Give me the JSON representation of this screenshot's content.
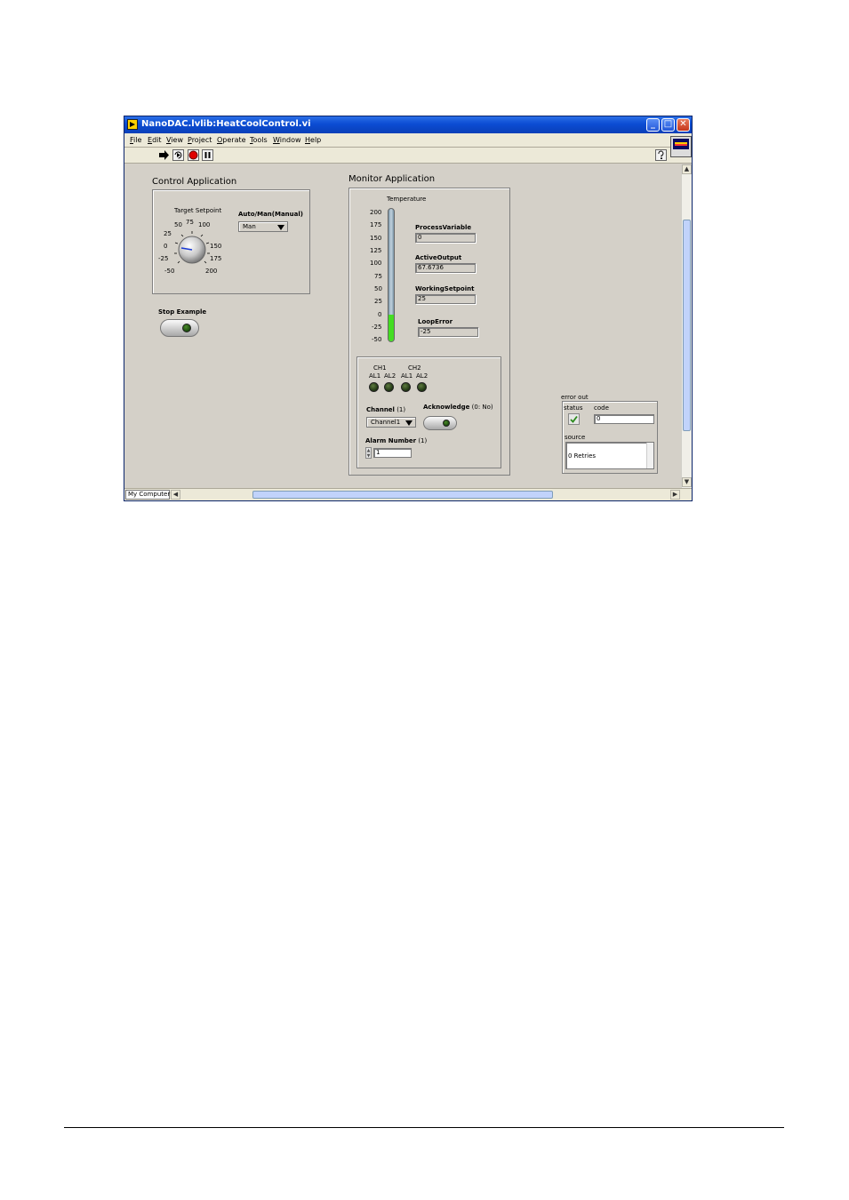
{
  "window": {
    "title": "NanoDAC.lvlib:HeatCoolControl.vi"
  },
  "menu": [
    "File",
    "Edit",
    "View",
    "Project",
    "Operate",
    "Tools",
    "Window",
    "Help"
  ],
  "control_app": {
    "title": "Control Application",
    "knob_label": "Target Setpoint",
    "knob_ticks": [
      "50",
      "75",
      "100",
      "25",
      "0",
      "-25",
      "-50",
      "150",
      "175",
      "200"
    ],
    "auto_man_label": "Auto/Man(Manual)",
    "auto_man_value": "Man",
    "stop_label": "Stop Example"
  },
  "monitor_app": {
    "title": "Monitor Application",
    "temperature_label": "Temperature",
    "temp_ticks": [
      "200",
      "175",
      "150",
      "125",
      "100",
      "75",
      "50",
      "25",
      "0",
      "-25",
      "-50"
    ],
    "temp_range": [
      -50,
      200
    ],
    "temperature_value": 0,
    "fill_color": "#44dd22",
    "process_variable_label": "ProcessVariable",
    "process_variable_value": "0",
    "active_output_label": "ActiveOutput",
    "active_output_value": "67.6736",
    "working_setpoint_label": "WorkingSetpoint",
    "working_setpoint_value": "25",
    "loop_error_label": "LoopError",
    "loop_error_value": "-25",
    "alarms": {
      "ch1": "CH1",
      "ch2": "CH2",
      "al1a": "AL1",
      "al2a": "AL2",
      "al1b": "AL1",
      "al2b": "AL2",
      "channel_label": "Channel",
      "channel_count": "(1)",
      "channel_value": "Channel1",
      "acknowledge_label": "Acknowledge",
      "acknowledge_hint": "(0: No)",
      "alarm_number_label": "Alarm Number",
      "alarm_number_count": "(1)",
      "alarm_number_value": "1"
    }
  },
  "error_out": {
    "title": "error out",
    "status_label": "status",
    "code_label": "code",
    "code_value": "0",
    "source_label": "source",
    "source_value": "0 Retries"
  },
  "statusbar": {
    "target": "My Computer"
  }
}
